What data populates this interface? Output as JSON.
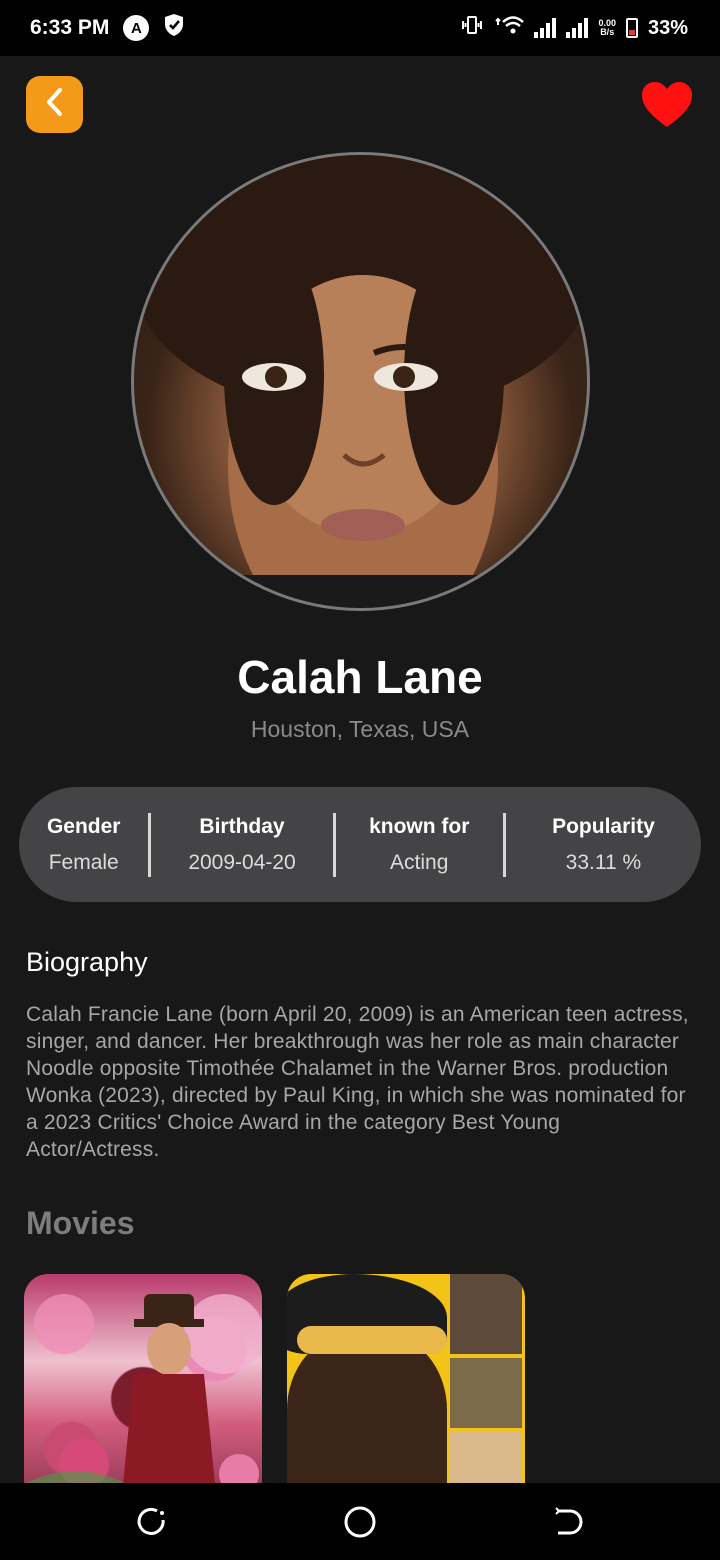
{
  "status_bar": {
    "time": "6:33 PM",
    "speed_top": "0.00",
    "speed_bottom": "B/s",
    "battery": "33%"
  },
  "profile": {
    "name": "Calah Lane",
    "place": "Houston, Texas, USA"
  },
  "info": [
    {
      "label": "Gender",
      "value": "Female"
    },
    {
      "label": "Birthday",
      "value": "2009-04-20"
    },
    {
      "label": "known for",
      "value": "Acting"
    },
    {
      "label": "Popularity",
      "value": "33.11 %"
    }
  ],
  "biography": {
    "heading": "Biography",
    "text": "Calah Francie Lane (born April 20, 2009) is an American teen actress, singer, and dancer. Her breakthrough was her role as main character Noodle opposite Timothée Chalamet in the Warner Bros. production Wonka (2023), directed by Paul King, in which she was nominated for a 2023 Critics' Choice Award in the category Best Young Actor/Actress."
  },
  "movies": {
    "heading": "Movies"
  },
  "colors": {
    "accent": "#f59a18",
    "heart": "#ff1111",
    "background": "#181819",
    "pill": "#444446"
  },
  "icons": {
    "back": "chevron-left-icon",
    "favorite": "heart-icon",
    "nav_recent": "recent-apps-icon",
    "nav_home": "home-icon",
    "nav_back": "back-icon"
  }
}
